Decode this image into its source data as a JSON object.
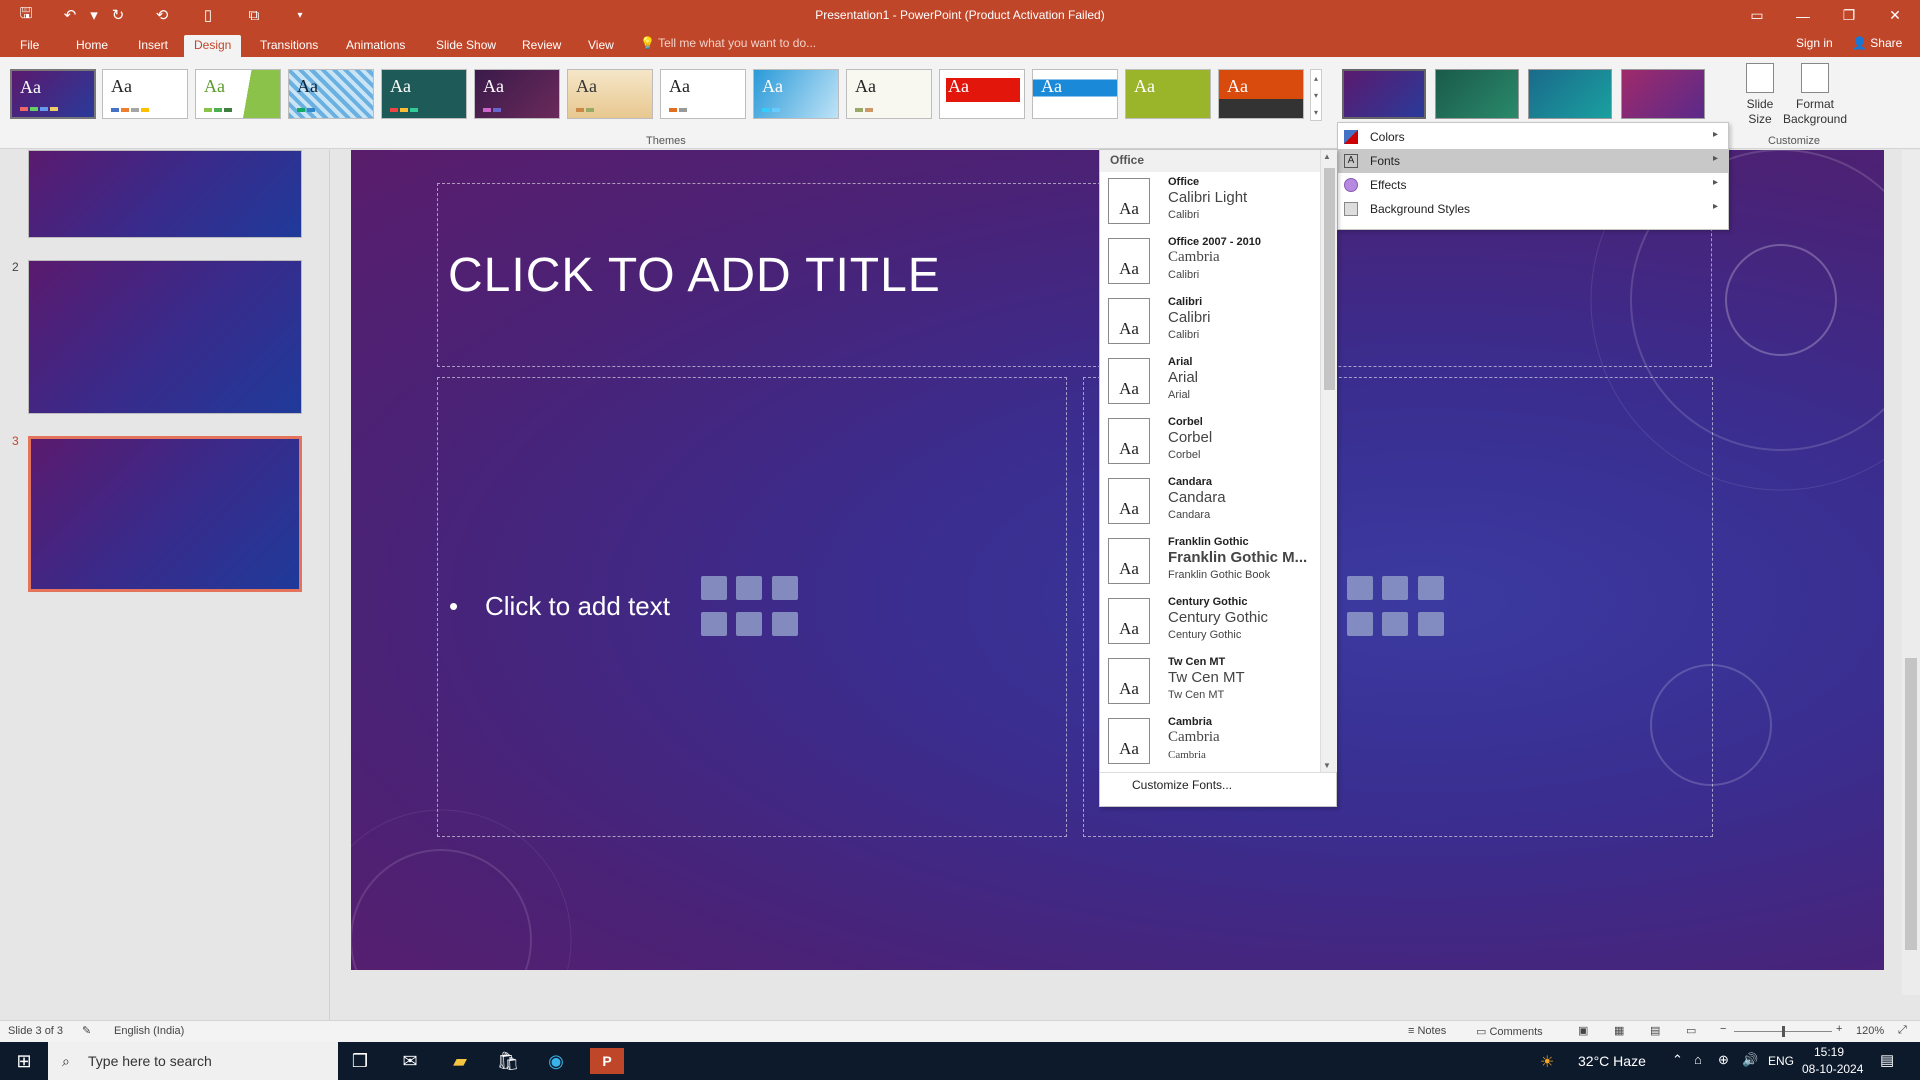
{
  "title_bar": {
    "title": "Presentation1  -  PowerPoint (Product Activation Failed)"
  },
  "tabs": [
    {
      "label": "File"
    },
    {
      "label": "Home"
    },
    {
      "label": "Insert"
    },
    {
      "label": "Design",
      "active": true
    },
    {
      "label": "Transitions"
    },
    {
      "label": "Animations"
    },
    {
      "label": "Slide Show"
    },
    {
      "label": "Review"
    },
    {
      "label": "View"
    }
  ],
  "tell_me": "Tell me what you want to do...",
  "sign_in": "Sign in",
  "share": "Share",
  "ribbon": {
    "themes_label": "Themes",
    "customize_label": "Customize",
    "theme_aa": "Aa",
    "slide_size": "Slide\nSize",
    "format_background": "Format\nBackground"
  },
  "design_menu": {
    "items": [
      {
        "label": "Colors"
      },
      {
        "label": "Fonts"
      },
      {
        "label": "Effects"
      },
      {
        "label": "Background Styles"
      }
    ]
  },
  "font_menu": {
    "header": "Office",
    "aa": "Aa",
    "items": [
      {
        "name": "Office",
        "heading": "Calibri Light",
        "body": "Calibri"
      },
      {
        "name": "Office 2007 - 2010",
        "heading": "Cambria",
        "body": "Calibri"
      },
      {
        "name": "Calibri",
        "heading": "Calibri",
        "body": "Calibri"
      },
      {
        "name": "Arial",
        "heading": "Arial",
        "body": "Arial"
      },
      {
        "name": "Corbel",
        "heading": "Corbel",
        "body": "Corbel"
      },
      {
        "name": "Candara",
        "heading": "Candara",
        "body": "Candara"
      },
      {
        "name": "Franklin Gothic",
        "heading": "Franklin Gothic M...",
        "body": "Franklin Gothic Book"
      },
      {
        "name": "Century Gothic",
        "heading": "Century Gothic",
        "body": "Century Gothic"
      },
      {
        "name": "Tw Cen MT",
        "heading": "Tw Cen MT",
        "body": "Tw Cen MT"
      },
      {
        "name": "Cambria",
        "heading": "Cambria",
        "body": "Cambria"
      }
    ],
    "customize": "Customize Fonts..."
  },
  "slides_pane": {
    "numbers": [
      "2",
      "3"
    ]
  },
  "slide": {
    "title_placeholder": "CLICK TO ADD TITLE",
    "text_placeholder": "Click to add text",
    "bullet": "•"
  },
  "status_bar": {
    "slide_info": "Slide 3 of 3",
    "language": "English (India)",
    "notes": "Notes",
    "comments": "Comments",
    "zoom": "120%"
  },
  "taskbar": {
    "search_placeholder": "Type here to search",
    "weather": "32°C  Haze",
    "lang": "ENG",
    "time": "15:19",
    "date": "08-10-2024"
  }
}
